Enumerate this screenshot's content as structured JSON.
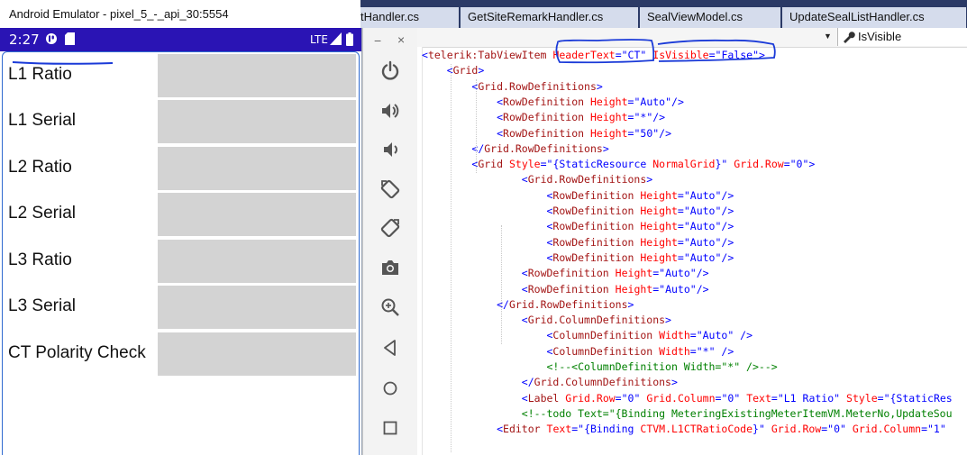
{
  "emulator": {
    "title": "Android Emulator - pixel_5_-_api_30:5554",
    "status": {
      "time": "2:27",
      "network": "LTE"
    },
    "rows": [
      {
        "label": "L1 Ratio",
        "value": ""
      },
      {
        "label": "L1 Serial",
        "value": ""
      },
      {
        "label": "L2 Ratio",
        "value": ""
      },
      {
        "label": "L2 Serial",
        "value": ""
      },
      {
        "label": "L3 Ratio",
        "value": ""
      },
      {
        "label": "L3 Serial",
        "value": ""
      },
      {
        "label": "CT Polarity Check",
        "value": ""
      }
    ],
    "toolbar": [
      "power-icon",
      "volume-up-icon",
      "volume-down-icon",
      "rotate-left-icon",
      "rotate-right-icon",
      "camera-icon",
      "zoom-icon",
      "back-icon",
      "home-icon",
      "overview-icon"
    ],
    "minimize": "−",
    "close": "×"
  },
  "editor": {
    "tabs": [
      "tHandler.cs",
      "GetSiteRemarkHandler.cs",
      "SealViewModel.cs",
      "UpdateSealListHandler.cs"
    ],
    "nav_right": "IsVisible",
    "colors": {
      "tag": "#a31515",
      "attr": "#ff0000",
      "value": "#0000ff",
      "comment": "#008000"
    },
    "lines": [
      [
        [
          "b",
          "<"
        ],
        [
          "n",
          "telerik:TabViewItem"
        ],
        [
          "t",
          " "
        ],
        [
          "a",
          "HeaderText"
        ],
        [
          "b",
          "=\""
        ],
        [
          "v",
          "CT"
        ],
        [
          "b",
          "\""
        ],
        [
          "t",
          " "
        ],
        [
          "a",
          "IsVisible"
        ],
        [
          "b",
          "=\""
        ],
        [
          "v",
          "False"
        ],
        [
          "b",
          "\">"
        ]
      ],
      [
        [
          "t",
          "    "
        ],
        [
          "b",
          "<"
        ],
        [
          "n",
          "Grid"
        ],
        [
          "b",
          ">"
        ]
      ],
      [
        [
          "t",
          "        "
        ],
        [
          "b",
          "<"
        ],
        [
          "n",
          "Grid.RowDefinitions"
        ],
        [
          "b",
          ">"
        ]
      ],
      [
        [
          "t",
          "            "
        ],
        [
          "b",
          "<"
        ],
        [
          "n",
          "RowDefinition"
        ],
        [
          "t",
          " "
        ],
        [
          "a",
          "Height"
        ],
        [
          "b",
          "=\""
        ],
        [
          "v",
          "Auto"
        ],
        [
          "b",
          "\"/>"
        ]
      ],
      [
        [
          "t",
          "            "
        ],
        [
          "b",
          "<"
        ],
        [
          "n",
          "RowDefinition"
        ],
        [
          "t",
          " "
        ],
        [
          "a",
          "Height"
        ],
        [
          "b",
          "=\""
        ],
        [
          "v",
          "*"
        ],
        [
          "b",
          "\"/>"
        ]
      ],
      [
        [
          "t",
          "            "
        ],
        [
          "b",
          "<"
        ],
        [
          "n",
          "RowDefinition"
        ],
        [
          "t",
          " "
        ],
        [
          "a",
          "Height"
        ],
        [
          "b",
          "=\""
        ],
        [
          "v",
          "50"
        ],
        [
          "b",
          "\"/>"
        ]
      ],
      [
        [
          "t",
          "        "
        ],
        [
          "b",
          "</"
        ],
        [
          "n",
          "Grid.RowDefinitions"
        ],
        [
          "b",
          ">"
        ]
      ],
      [
        [
          "t",
          "        "
        ],
        [
          "b",
          "<"
        ],
        [
          "n",
          "Grid"
        ],
        [
          "t",
          " "
        ],
        [
          "a",
          "Style"
        ],
        [
          "b",
          "=\""
        ],
        [
          "v",
          "{StaticResource "
        ],
        [
          "a",
          "NormalGrid"
        ],
        [
          "v",
          "}"
        ],
        [
          "b",
          "\""
        ],
        [
          "t",
          " "
        ],
        [
          "a",
          "Grid.Row"
        ],
        [
          "b",
          "=\""
        ],
        [
          "v",
          "0"
        ],
        [
          "b",
          "\">"
        ]
      ],
      [
        [
          "t",
          "                "
        ],
        [
          "b",
          "<"
        ],
        [
          "n",
          "Grid.RowDefinitions"
        ],
        [
          "b",
          ">"
        ]
      ],
      [
        [
          "t",
          "                    "
        ],
        [
          "b",
          "<"
        ],
        [
          "n",
          "RowDefinition"
        ],
        [
          "t",
          " "
        ],
        [
          "a",
          "Height"
        ],
        [
          "b",
          "=\""
        ],
        [
          "v",
          "Auto"
        ],
        [
          "b",
          "\"/>"
        ]
      ],
      [
        [
          "t",
          "                    "
        ],
        [
          "b",
          "<"
        ],
        [
          "n",
          "RowDefinition"
        ],
        [
          "t",
          " "
        ],
        [
          "a",
          "Height"
        ],
        [
          "b",
          "=\""
        ],
        [
          "v",
          "Auto"
        ],
        [
          "b",
          "\"/>"
        ]
      ],
      [
        [
          "t",
          "                    "
        ],
        [
          "b",
          "<"
        ],
        [
          "n",
          "RowDefinition"
        ],
        [
          "t",
          " "
        ],
        [
          "a",
          "Height"
        ],
        [
          "b",
          "=\""
        ],
        [
          "v",
          "Auto"
        ],
        [
          "b",
          "\"/>"
        ]
      ],
      [
        [
          "t",
          "                    "
        ],
        [
          "b",
          "<"
        ],
        [
          "n",
          "RowDefinition"
        ],
        [
          "t",
          " "
        ],
        [
          "a",
          "Height"
        ],
        [
          "b",
          "=\""
        ],
        [
          "v",
          "Auto"
        ],
        [
          "b",
          "\"/>"
        ]
      ],
      [
        [
          "t",
          "                    "
        ],
        [
          "b",
          "<"
        ],
        [
          "n",
          "RowDefinition"
        ],
        [
          "t",
          " "
        ],
        [
          "a",
          "Height"
        ],
        [
          "b",
          "=\""
        ],
        [
          "v",
          "Auto"
        ],
        [
          "b",
          "\"/>"
        ]
      ],
      [
        [
          "t",
          "                "
        ],
        [
          "b",
          "<"
        ],
        [
          "n",
          "RowDefinition"
        ],
        [
          "t",
          " "
        ],
        [
          "a",
          "Height"
        ],
        [
          "b",
          "=\""
        ],
        [
          "v",
          "Auto"
        ],
        [
          "b",
          "\"/>"
        ]
      ],
      [
        [
          "t",
          "                "
        ],
        [
          "b",
          "<"
        ],
        [
          "n",
          "RowDefinition"
        ],
        [
          "t",
          " "
        ],
        [
          "a",
          "Height"
        ],
        [
          "b",
          "=\""
        ],
        [
          "v",
          "Auto"
        ],
        [
          "b",
          "\"/>"
        ]
      ],
      [
        [
          "t",
          "            "
        ],
        [
          "b",
          "</"
        ],
        [
          "n",
          "Grid.RowDefinitions"
        ],
        [
          "b",
          ">"
        ]
      ],
      [
        [
          "t",
          "                "
        ],
        [
          "b",
          "<"
        ],
        [
          "n",
          "Grid.ColumnDefinitions"
        ],
        [
          "b",
          ">"
        ]
      ],
      [
        [
          "t",
          "                    "
        ],
        [
          "b",
          "<"
        ],
        [
          "n",
          "ColumnDefinition"
        ],
        [
          "t",
          " "
        ],
        [
          "a",
          "Width"
        ],
        [
          "b",
          "=\""
        ],
        [
          "v",
          "Auto"
        ],
        [
          "b",
          "\" />"
        ]
      ],
      [
        [
          "t",
          "                    "
        ],
        [
          "b",
          "<"
        ],
        [
          "n",
          "ColumnDefinition"
        ],
        [
          "t",
          " "
        ],
        [
          "a",
          "Width"
        ],
        [
          "b",
          "=\""
        ],
        [
          "v",
          "*"
        ],
        [
          "b",
          "\" />"
        ]
      ],
      [
        [
          "t",
          "                    "
        ],
        [
          "c",
          "<!--<ColumnDefinition Width=\"*\" />-->"
        ]
      ],
      [
        [
          "t",
          "                "
        ],
        [
          "b",
          "</"
        ],
        [
          "n",
          "Grid.ColumnDefinitions"
        ],
        [
          "b",
          ">"
        ]
      ],
      [
        [
          "t",
          "                "
        ],
        [
          "b",
          "<"
        ],
        [
          "n",
          "Label"
        ],
        [
          "t",
          " "
        ],
        [
          "a",
          "Grid.Row"
        ],
        [
          "b",
          "=\""
        ],
        [
          "v",
          "0"
        ],
        [
          "b",
          "\""
        ],
        [
          "t",
          " "
        ],
        [
          "a",
          "Grid.Column"
        ],
        [
          "b",
          "=\""
        ],
        [
          "v",
          "0"
        ],
        [
          "b",
          "\""
        ],
        [
          "t",
          " "
        ],
        [
          "a",
          "Text"
        ],
        [
          "b",
          "=\""
        ],
        [
          "v",
          "L1 Ratio"
        ],
        [
          "b",
          "\""
        ],
        [
          "t",
          " "
        ],
        [
          "a",
          "Style"
        ],
        [
          "b",
          "=\""
        ],
        [
          "v",
          "{StaticRes"
        ]
      ],
      [
        [
          "t",
          "                "
        ],
        [
          "c",
          "<!--todo Text=\"{Binding MeteringExistingMeterItemVM.MeterNo,UpdateSou"
        ]
      ],
      [
        [
          "t",
          "            "
        ],
        [
          "b",
          "<"
        ],
        [
          "n",
          "Editor"
        ],
        [
          "t",
          " "
        ],
        [
          "a",
          "Text"
        ],
        [
          "b",
          "=\""
        ],
        [
          "v",
          "{Binding "
        ],
        [
          "a",
          "CTVM.L1CTRatioCode"
        ],
        [
          "v",
          "}"
        ],
        [
          "b",
          "\""
        ],
        [
          "t",
          " "
        ],
        [
          "a",
          "Grid.Row"
        ],
        [
          "b",
          "=\""
        ],
        [
          "v",
          "0"
        ],
        [
          "b",
          "\""
        ],
        [
          "t",
          " "
        ],
        [
          "a",
          "Grid.Column"
        ],
        [
          "b",
          "=\""
        ],
        [
          "v",
          "1"
        ],
        [
          "b",
          "\""
        ]
      ]
    ]
  }
}
